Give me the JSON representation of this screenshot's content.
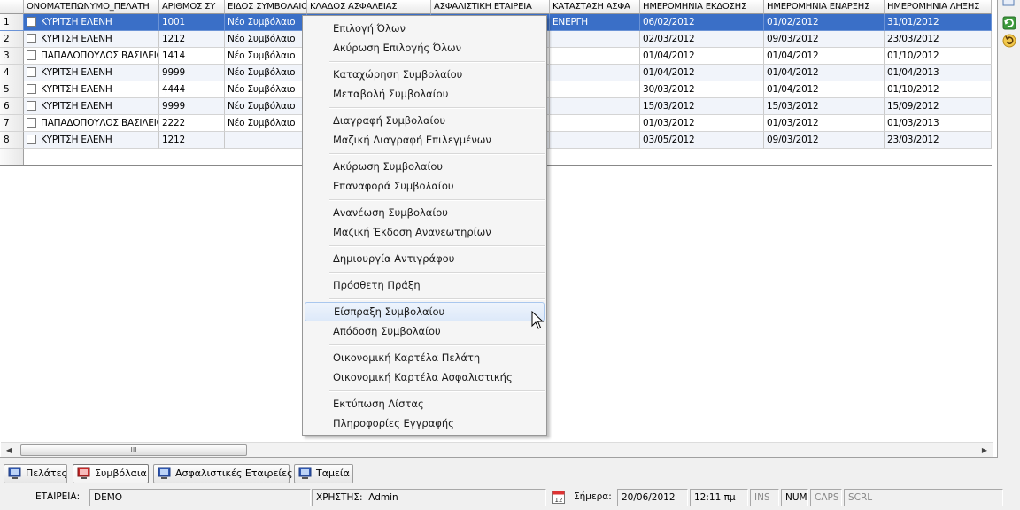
{
  "grid": {
    "columns": [
      "",
      "ΟΝΟΜΑΤΕΠΩΝΥΜΟ_ΠΕΛΑΤΗ",
      "ΑΡΙΘΜΟΣ ΣΥ",
      "ΕΙΔΟΣ ΣΥΜΒΟΛΑΙΟΥ",
      "ΚΛΑΔΟΣ ΑΣΦΑΛΕΙΑΣ",
      "ΑΣΦΑΛΙΣΤΙΚΗ ΕΤΑΙΡΕΙΑ",
      "ΚΑΤΑΣΤΑΣΗ ΑΣΦΑ",
      "ΗΜΕΡΟΜΗΝΙΑ ΕΚΔΟΣΗΣ",
      "ΗΜΕΡΟΜΗΝΙΑ ΕΝΑΡΞΗΣ",
      "ΗΜΕΡΟΜΗΝΙΑ ΛΗΞΗΣ"
    ],
    "rows": [
      {
        "num": "1",
        "client": "ΚΥΡΙΤΣΗ ΕΛΕΝΗ",
        "number": "1001",
        "type": "Νέο Συμβόλαιο",
        "branch": "",
        "company": "",
        "status": "ΕΝΕΡΓΗ",
        "issue": "06/02/2012",
        "start": "01/02/2012",
        "end": "31/01/2012"
      },
      {
        "num": "2",
        "client": "ΚΥΡΙΤΣΗ ΕΛΕΝΗ",
        "number": "1212",
        "type": "Νέο Συμβόλαιο",
        "branch": "",
        "company": "",
        "status": "",
        "issue": "02/03/2012",
        "start": "09/03/2012",
        "end": "23/03/2012"
      },
      {
        "num": "3",
        "client": "ΠΑΠΑΔΟΠΟΥΛΟΣ ΒΑΣΙΛΕΙΟΣ",
        "number": "1414",
        "type": "Νέο Συμβόλαιο",
        "branch": "",
        "company": "",
        "status": "",
        "issue": "01/04/2012",
        "start": "01/04/2012",
        "end": "01/10/2012"
      },
      {
        "num": "4",
        "client": "ΚΥΡΙΤΣΗ ΕΛΕΝΗ",
        "number": "9999",
        "type": "Νέο Συμβόλαιο",
        "branch": "",
        "company": "",
        "status": "",
        "issue": "01/04/2012",
        "start": "01/04/2012",
        "end": "01/04/2013"
      },
      {
        "num": "5",
        "client": "ΚΥΡΙΤΣΗ ΕΛΕΝΗ",
        "number": "4444",
        "type": "Νέο Συμβόλαιο",
        "branch": "",
        "company": "",
        "status": "",
        "issue": "30/03/2012",
        "start": "01/04/2012",
        "end": "01/10/2012"
      },
      {
        "num": "6",
        "client": "ΚΥΡΙΤΣΗ ΕΛΕΝΗ",
        "number": "9999",
        "type": "Νέο Συμβόλαιο",
        "branch": "",
        "company": "",
        "status": "",
        "issue": "15/03/2012",
        "start": "15/03/2012",
        "end": "15/09/2012"
      },
      {
        "num": "7",
        "client": "ΠΑΠΑΔΟΠΟΥΛΟΣ ΒΑΣΙΛΕΙΟΣ",
        "number": "2222",
        "type": "Νέο Συμβόλαιο",
        "branch": "",
        "company": "",
        "status": "",
        "issue": "01/03/2012",
        "start": "01/03/2012",
        "end": "01/03/2013"
      },
      {
        "num": "8",
        "client": "ΚΥΡΙΤΣΗ ΕΛΕΝΗ",
        "number": "1212",
        "type": "",
        "branch": "",
        "company": "",
        "status": "",
        "issue": "03/05/2012",
        "start": "09/03/2012",
        "end": "23/03/2012"
      }
    ],
    "scroll_thumb_label": "III"
  },
  "context_menu": {
    "items": [
      "Επιλογή Όλων",
      "Ακύρωση Επιλογής Όλων",
      "Καταχώρηση Συμβολαίου",
      "Μεταβολή Συμβολαίου",
      "Διαγραφή Συμβολαίου",
      "Μαζική Διαγραφή Επιλεγμένων",
      "Ακύρωση Συμβολαίου",
      "Επαναφορά Συμβολαίου",
      "Ανανέωση Συμβολαίου",
      "Μαζική Έκδοση Ανανεωτηρίων",
      "Δημιουργία Αντιγράφου",
      "Πρόσθετη Πράξη",
      "Είσπραξη Συμβολαίου",
      "Απόδοση Συμβολαίου",
      "Οικονομική Καρτέλα Πελάτη",
      "Οικονομική Καρτέλα Ασφαλιστικής",
      "Εκτύπωση Λίστας",
      "Πληροφορίες Εγγραφής"
    ],
    "hovered_item": "Είσπραξη Συμβολαίου"
  },
  "tabs": [
    {
      "label": "Πελάτες",
      "icon": "monitor-icon"
    },
    {
      "label": "Συμβόλαια",
      "icon": "monitor-red-icon",
      "active": true
    },
    {
      "label": "Ασφαλιστικές Εταιρείες",
      "icon": "monitor-icon"
    },
    {
      "label": "Ταμεία",
      "icon": "monitor-icon"
    }
  ],
  "status": {
    "company_label": "ΕΤΑΙΡΕΙΑ:",
    "company_value": "DEMO",
    "user_label": "ΧΡΗΣΤΗΣ:",
    "user_value": "Admin",
    "calendar_day": "12",
    "today_label": "Σήμερα:",
    "date": "20/06/2012",
    "time": "12:11 πμ",
    "ins": "INS",
    "num": "NUM",
    "caps": "CAPS",
    "scrl": "SCRL"
  },
  "colors": {
    "selection": "#3a6fc7",
    "alt_row": "#f1f4fa",
    "menu_hover": "#dde9f9"
  }
}
